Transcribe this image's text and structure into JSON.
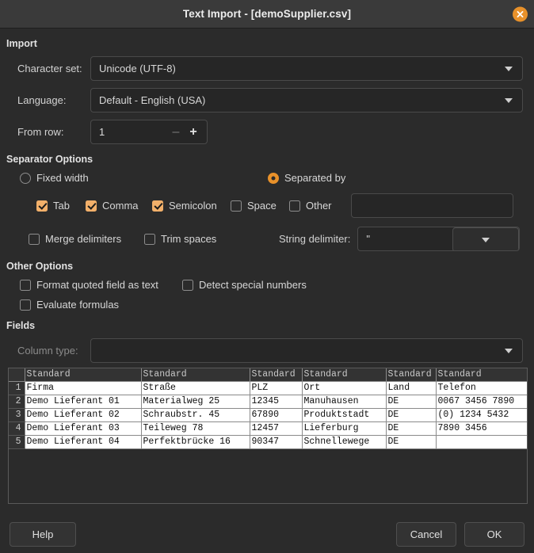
{
  "window": {
    "title": "Text Import - [demoSupplier.csv]",
    "close_icon": "close-icon"
  },
  "import": {
    "section_title": "Import",
    "charset_label": "Character set:",
    "charset_value": "Unicode (UTF-8)",
    "language_label": "Language:",
    "language_value": "Default - English (USA)",
    "from_row_label": "From row:",
    "from_row_value": "1",
    "minus_label": "–",
    "plus_label": "+"
  },
  "separator": {
    "section_title": "Separator Options",
    "fixed_width_label": "Fixed width",
    "fixed_width_checked": false,
    "separated_by_label": "Separated by",
    "separated_by_checked": true,
    "options": [
      {
        "label": "Tab",
        "checked": true
      },
      {
        "label": "Comma",
        "checked": true
      },
      {
        "label": "Semicolon",
        "checked": true
      },
      {
        "label": "Space",
        "checked": false
      },
      {
        "label": "Other",
        "checked": false
      }
    ],
    "other_value": "",
    "merge_delimiters_label": "Merge delimiters",
    "merge_delimiters_checked": false,
    "trim_spaces_label": "Trim spaces",
    "trim_spaces_checked": false,
    "string_delimiter_label": "String delimiter:",
    "string_delimiter_value": "\""
  },
  "other_options": {
    "section_title": "Other Options",
    "format_quoted_label": "Format quoted field as text",
    "format_quoted_checked": false,
    "detect_special_label": "Detect special numbers",
    "detect_special_checked": false,
    "evaluate_formulas_label": "Evaluate formulas",
    "evaluate_formulas_checked": false
  },
  "fields": {
    "section_title": "Fields",
    "column_type_label": "Column type:",
    "column_type_value": "",
    "column_headers": [
      "Standard",
      "Standard",
      "Standard",
      "Standard",
      "Standard",
      "Standard"
    ],
    "rows": [
      {
        "num": "1",
        "cells": [
          "Firma",
          "Straße",
          "PLZ",
          "Ort",
          "Land",
          "Telefon"
        ]
      },
      {
        "num": "2",
        "cells": [
          "Demo Lieferant 01",
          "Materialweg 25",
          "12345",
          "Manuhausen",
          "DE",
          "0067 3456 7890"
        ]
      },
      {
        "num": "3",
        "cells": [
          "Demo Lieferant 02",
          "Schraubstr. 45",
          "67890",
          "Produktstadt",
          "DE",
          "(0) 1234 5432"
        ]
      },
      {
        "num": "4",
        "cells": [
          "Demo Lieferant 03",
          "Teileweg 78",
          "12457",
          "Lieferburg",
          "DE",
          "7890 3456"
        ]
      },
      {
        "num": "5",
        "cells": [
          "Demo Lieferant 04",
          "Perfektbrücke 16",
          "90347",
          "Schnellewege",
          "DE",
          ""
        ]
      }
    ]
  },
  "footer": {
    "help_label": "Help",
    "cancel_label": "Cancel",
    "ok_label": "OK"
  },
  "colors": {
    "accent": "#e8912a",
    "checkbox": "#f2b06a",
    "window_bg": "#2b2b2b",
    "titlebar_bg": "#3a3a3a"
  }
}
